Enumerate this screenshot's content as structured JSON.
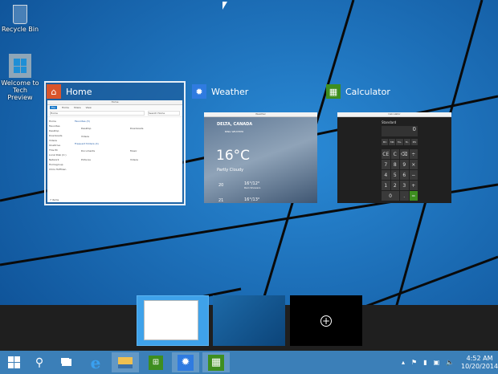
{
  "desktop": {
    "icons": [
      {
        "label": "Recycle Bin",
        "icon": "recycle-bin-icon"
      },
      {
        "label": "Welcome to Tech Preview",
        "icon": "windows-shortcut-icon"
      }
    ]
  },
  "task_view": {
    "windows": [
      {
        "title": "Home",
        "icon": "home-folder-icon",
        "accent": "#d9552b",
        "selected": true,
        "content": {
          "window_title": "Home",
          "ribbon": [
            "File",
            "Home",
            "Share",
            "View"
          ],
          "address": "Home",
          "search": "Search Home",
          "nav": [
            "Home",
            "Favorites",
            "Desktop",
            "Downloads",
            "Videos",
            "OneDrive",
            "This PC",
            "Local Disk (C:)",
            "Network",
            "Homegroup",
            "Chris Hoffman"
          ],
          "favorites_header": "Favorites (3)",
          "favorites": [
            "Desktop",
            "Downloads",
            "Videos"
          ],
          "frequent_header": "Frequent folders (4)",
          "frequent": [
            "Documents",
            "Music",
            "Pictures",
            "Videos"
          ],
          "status": "7 items"
        }
      },
      {
        "title": "Weather",
        "icon": "sun-icon",
        "accent": "#2f7be0",
        "content": {
          "window_title": "Weather",
          "location": "DELTA, CANADA",
          "source": "BING WEATHER",
          "temp": "16°C",
          "condition": "Partly Cloudy",
          "forecast": [
            {
              "day": "20",
              "range": "16°/12°",
              "desc": "Rain Showers"
            },
            {
              "day": "21",
              "range": "16°/13°"
            }
          ]
        }
      },
      {
        "title": "Calculator",
        "icon": "calculator-icon",
        "accent": "#3e8e1f",
        "content": {
          "window_title": "Calculator",
          "mode": "Standard",
          "display": "0",
          "memory": [
            "MC",
            "MR",
            "M+",
            "M-",
            "MS"
          ],
          "keys": [
            "CE",
            "C",
            "⌫",
            "÷",
            "7",
            "8",
            "9",
            "×",
            "4",
            "5",
            "6",
            "−",
            "1",
            "2",
            "3",
            "+",
            "0",
            ".",
            "="
          ]
        }
      }
    ]
  },
  "desktops": {
    "add_label": "+"
  },
  "taskbar": {
    "items": [
      "start",
      "search",
      "task-view",
      "internet-explorer",
      "file-explorer",
      "store",
      "weather",
      "calculator"
    ],
    "time": "4:52 AM",
    "date": "10/20/2014"
  }
}
